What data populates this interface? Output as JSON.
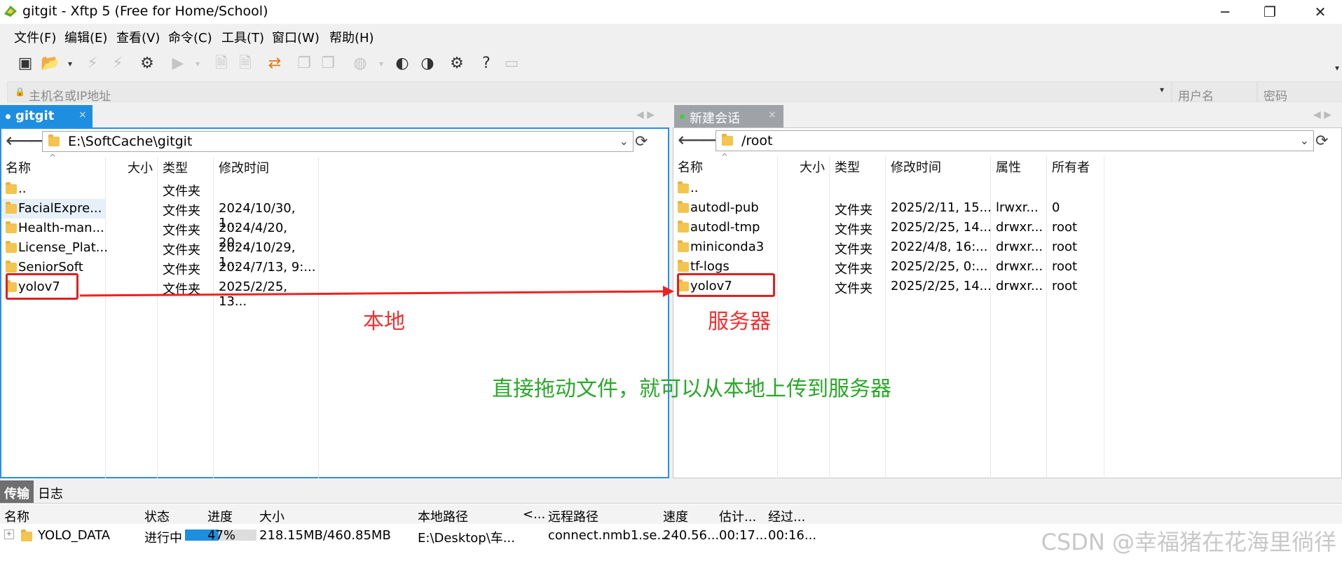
{
  "window": {
    "title": "gitgit - Xftp 5 (Free for Home/School)"
  },
  "menu": [
    "文件(F)",
    "编辑(E)",
    "查看(V)",
    "命令(C)",
    "工具(T)",
    "窗口(W)",
    "帮助(H)"
  ],
  "address": {
    "placeholder": "主机名或IP地址",
    "user_placeholder": "用户名",
    "pass_placeholder": "密码"
  },
  "left": {
    "tab": "gitgit",
    "path": "E:\\SoftCache\\gitgit",
    "columns": [
      "名称",
      "大小",
      "类型",
      "修改时间"
    ],
    "rows": [
      {
        "name": "..",
        "type": "文件夹",
        "modified": ""
      },
      {
        "name": "FacialExpre...",
        "type": "文件夹",
        "modified": "2024/10/30, 1..."
      },
      {
        "name": "Health-man...",
        "type": "文件夹",
        "modified": "2024/4/20, 20..."
      },
      {
        "name": "License_Plat...",
        "type": "文件夹",
        "modified": "2024/10/29, 1..."
      },
      {
        "name": "SeniorSoft",
        "type": "文件夹",
        "modified": "2024/7/13, 9:..."
      },
      {
        "name": "yolov7",
        "type": "文件夹",
        "modified": "2025/2/25, 13..."
      }
    ]
  },
  "right": {
    "tab": "新建会话",
    "path": "/root",
    "columns": [
      "名称",
      "大小",
      "类型",
      "修改时间",
      "属性",
      "所有者"
    ],
    "rows": [
      {
        "name": "..",
        "type": "",
        "modified": "",
        "attr": "",
        "owner": ""
      },
      {
        "name": "autodl-pub",
        "type": "文件夹",
        "modified": "2025/2/11, 15...",
        "attr": "lrwxr...",
        "owner": "0"
      },
      {
        "name": "autodl-tmp",
        "type": "文件夹",
        "modified": "2025/2/25, 14...",
        "attr": "drwxr...",
        "owner": "root"
      },
      {
        "name": "miniconda3",
        "type": "文件夹",
        "modified": "2022/4/8, 16:...",
        "attr": "drwxr...",
        "owner": "root"
      },
      {
        "name": "tf-logs",
        "type": "文件夹",
        "modified": "2025/2/25, 0:...",
        "attr": "drwxr...",
        "owner": "root"
      },
      {
        "name": "yolov7",
        "type": "文件夹",
        "modified": "2025/2/25, 14...",
        "attr": "drwxr...",
        "owner": "root"
      }
    ]
  },
  "annotations": {
    "local": "本地",
    "server": "服务器",
    "instruction": "直接拖动文件，就可以从本地上传到服务器"
  },
  "transfer": {
    "tabs": [
      "传输",
      "日志"
    ],
    "columns": [
      "名称",
      "状态",
      "进度",
      "大小",
      "本地路径",
      "<...",
      "远程路径",
      "速度",
      "估计...",
      "经过..."
    ],
    "row": {
      "name": "YOLO_DATA",
      "status": "进行中",
      "progress": "47%",
      "progress_value": 0.47,
      "size": "218.15MB/460.85MB",
      "local": "E:\\Desktop\\车...",
      "remote": "connect.nmb1.se...",
      "speed": "240.56...",
      "eta": "00:17...",
      "elapsed": "00:16..."
    }
  },
  "watermark": "CSDN @幸福猪在花海里徜徉"
}
